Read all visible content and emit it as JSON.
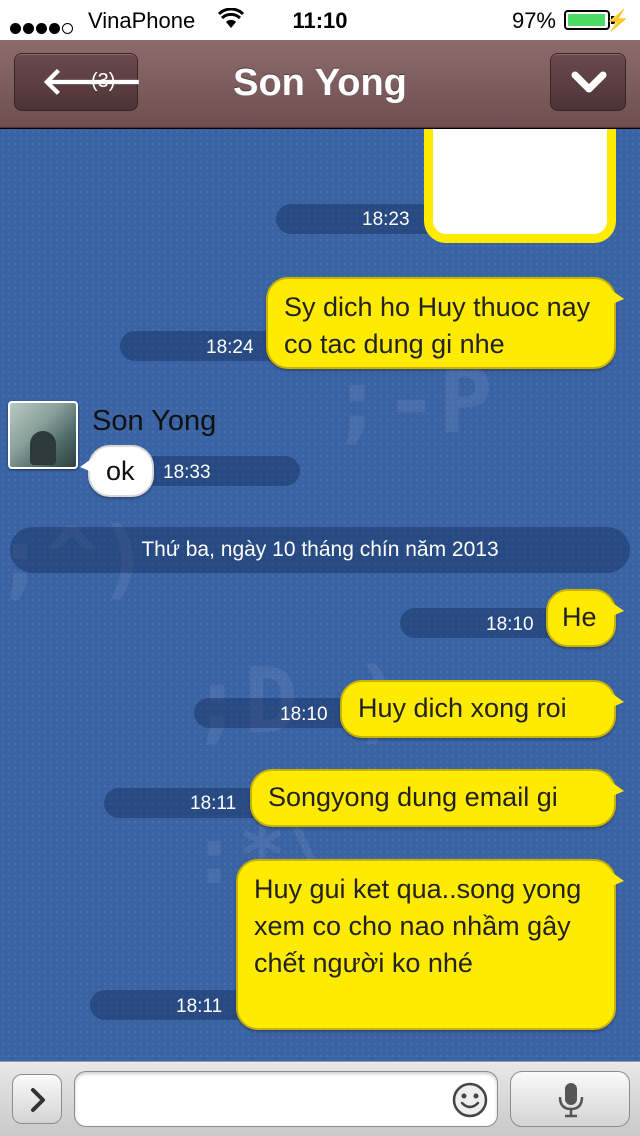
{
  "status_bar": {
    "carrier": "VinaPhone",
    "signal_bars": 4,
    "signal_bars_total": 5,
    "time": "11:10",
    "battery_percent_label": "97%",
    "battery_level": 0.97
  },
  "nav": {
    "back_icon": "arrow-left-icon",
    "back_count": "(3)",
    "title": "Son Yong",
    "menu_icon": "chevron-down-icon"
  },
  "messages": {
    "m0_time": "18:23",
    "m1_text": "Sy dich ho Huy thuoc nay co tac dung gi nhe",
    "m1_time": "18:24",
    "m2_sender": "Son Yong",
    "m2_text": "ok",
    "m2_time": "18:33",
    "date_divider": "Thứ ba, ngày 10 tháng chín năm 2013",
    "m3_text": "He",
    "m3_time": "18:10",
    "m4_text": "Huy dich xong roi",
    "m4_time": "18:10",
    "m5_text": "Songyong dung email gi",
    "m5_time": "18:11",
    "m6_text": "Huy gui ket qua..song yong xem co cho nao nhầm gây chết người ko nhé",
    "m6_time": "18:11"
  },
  "input": {
    "placeholder": "",
    "expand_icon": "chevron-right-icon",
    "emoji_icon": "smiley-icon",
    "mic_icon": "microphone-icon"
  },
  "colors": {
    "nav_bg": "#7c5c5e",
    "chat_bg": "#3a63a4",
    "outgoing_bubble": "#ffeb00",
    "incoming_bubble": "#ffffff"
  }
}
